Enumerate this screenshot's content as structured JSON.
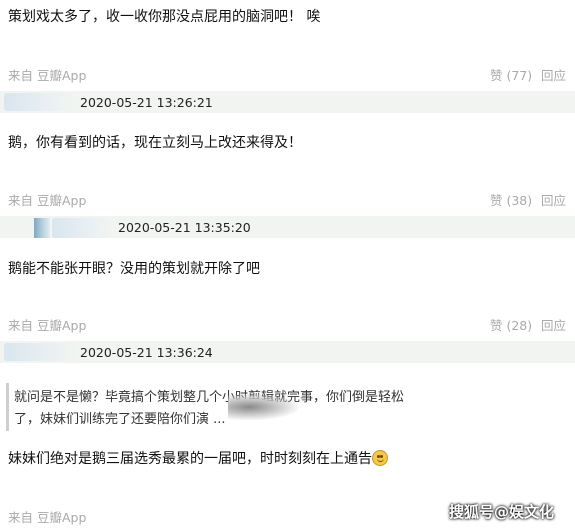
{
  "comments": [
    {
      "text": "策划戏太多了，收一收你那没点屁用的脑洞吧！ 唉",
      "source": "来自 豆瓣App",
      "likes": "赞 (77)",
      "reply": "回应"
    },
    {
      "timestamp": "2020-05-21 13:26:21",
      "text": "鹅，你有看到的话，现在立刻马上改还来得及！",
      "source": "来自 豆瓣App",
      "likes": "赞 (38)",
      "reply": "回应"
    },
    {
      "timestamp": "2020-05-21 13:35:20",
      "text": "鹅能不能张开眼？没用的策划就开除了吧",
      "source": "来自 豆瓣App",
      "likes": "赞 (28)",
      "reply": "回应"
    },
    {
      "timestamp": "2020-05-21 13:36:24",
      "quote_line1": "就问是不是懒？毕竟搞个策划整几个小时剪辑就完事，你们倒是轻松",
      "quote_line2": "了，妹妹们训练完了还要陪你们演 ...",
      "text": "妹妹们绝对是鹅三届选秀最累的一届吧，时时刻刻在上通告",
      "source": "来自 豆瓣App"
    }
  ],
  "watermark": "搜狐号@娱文化",
  "icons": {
    "emoji": "smile-emoji-icon",
    "avatar_blur": "blurred-avatar"
  }
}
